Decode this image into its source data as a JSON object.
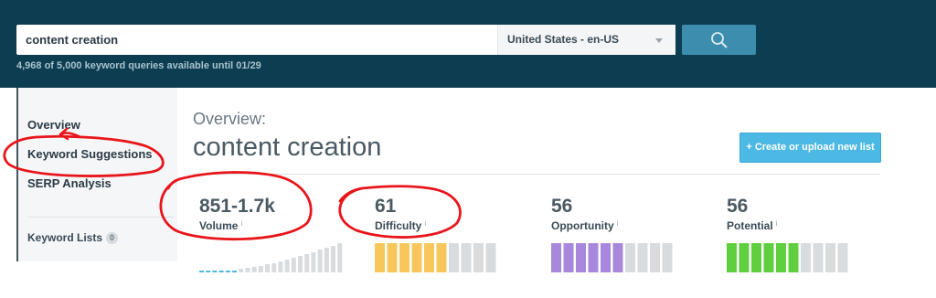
{
  "search": {
    "query": "content creation",
    "locale": "United States - en-US",
    "quota": "4,968 of 5,000 keyword queries available until 01/29"
  },
  "sidebar": {
    "items": [
      {
        "label": "Overview"
      },
      {
        "label": "Keyword Suggestions"
      },
      {
        "label": "SERP Analysis"
      }
    ],
    "lists_label": "Keyword Lists",
    "lists_count": "0"
  },
  "main": {
    "overview_label": "Overview:",
    "title": "content creation",
    "create_button": "+ Create or upload new list"
  },
  "metrics": [
    {
      "value": "851-1.7k",
      "label": "Volume",
      "info": "i"
    },
    {
      "value": "61",
      "label": "Difficulty",
      "info": "i",
      "level": 61,
      "color": "#f7c75b"
    },
    {
      "value": "56",
      "label": "Opportunity",
      "info": "i",
      "level": 56,
      "color": "#a888dc"
    },
    {
      "value": "56",
      "label": "Potential",
      "info": "i",
      "level": 56,
      "color": "#5fcf3f"
    }
  ],
  "colors": {
    "header": "#0d3d50",
    "search_button": "#3d8eae",
    "create_button": "#4cb8e4",
    "meter_empty": "#d8dcdf",
    "volume_active": "#4cb8e4",
    "annotation": "#e8151b"
  }
}
